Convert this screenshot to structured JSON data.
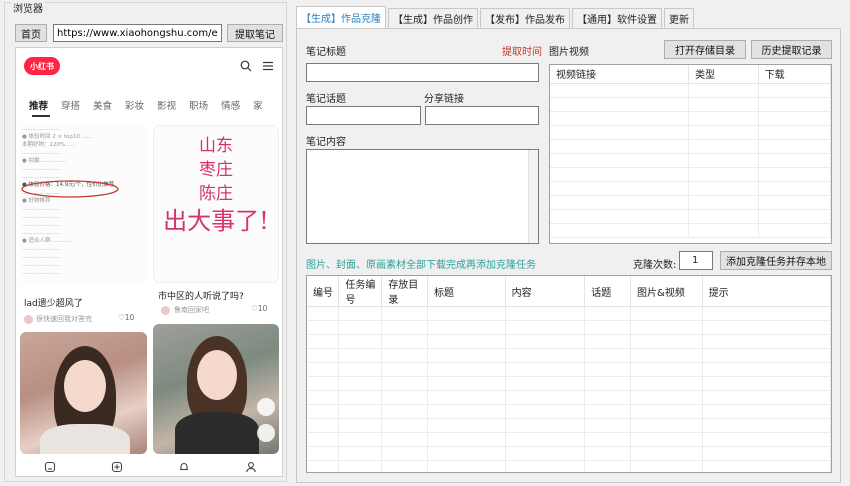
{
  "browser": {
    "group_title": "浏览器",
    "home_label": "首页",
    "url_value": "https://www.xiaohongshu.com/explore",
    "extract_label": "提取笔记"
  },
  "xhs": {
    "logo": "小红书",
    "tabs": [
      "推荐",
      "穿搭",
      "美食",
      "彩妆",
      "影视",
      "职场",
      "情感",
      "家"
    ],
    "card1": {
      "text_lines": [
        "......................",
        "● 体验时间 2 × top10 ......",
        "本期好物：120%......",
        "......................",
        "● 拍摄...............",
        "......................",
        "......................",
        "● 体验价格：14.9元/个，性价比推荐",
        "......................",
        "● 好物推荐",
        "......................",
        "......................",
        "......................",
        "......................",
        "● 适合人群............",
        "......................",
        "......................",
        "......................",
        "......................"
      ],
      "title": "lad遗少超风了",
      "author": "很快速回我对答完",
      "likes": "♡10"
    },
    "card2": {
      "handwriting": [
        "山东",
        "枣庄",
        "陈庄",
        "出大事了!"
      ],
      "title": "市中区的人听说了吗?",
      "author": "鲁南回家吧",
      "likes": "♡10"
    }
  },
  "tabs": [
    "【生成】作品克隆",
    "【生成】作品创作",
    "【发布】作品发布",
    "【通用】软件设置",
    "更新"
  ],
  "form": {
    "title_label": "笔记标题",
    "extract_time_label": "提取时间",
    "topic_label": "笔记话题",
    "share_label": "分享链接",
    "content_label": "笔记内容"
  },
  "media": {
    "label": "图片视频",
    "open_dir_btn": "打开存储目录",
    "history_btn": "历史提取记录",
    "columns": [
      "视频链接",
      "类型",
      "下载"
    ]
  },
  "clone": {
    "message": "图片、封面、原画素材全部下载完成再添加克隆任务",
    "count_label": "克隆次数:",
    "count_value": "1",
    "add_btn": "添加克隆任务并存本地"
  },
  "task_table": {
    "columns": [
      "编号",
      "任务编号",
      "存放目录",
      "标题",
      "内容",
      "话题",
      "图片&视频",
      "提示"
    ]
  },
  "colors": {
    "accent": "#2a7fc0",
    "warn": "#c0392b",
    "brand": "#ff2442",
    "message": "#2aa198"
  }
}
